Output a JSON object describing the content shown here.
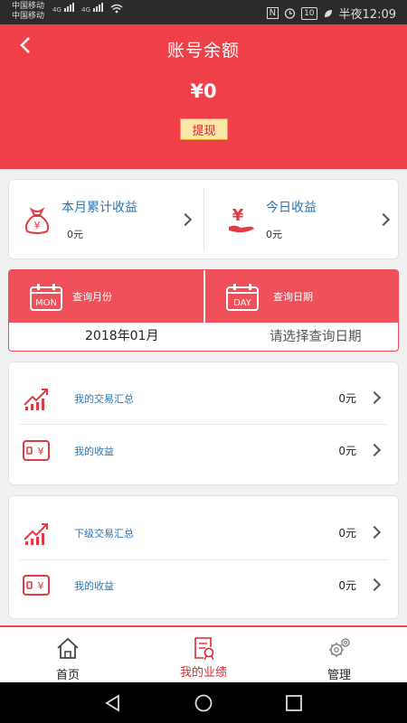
{
  "status": {
    "carrier1": "中国移动",
    "carrier2": "中国移动",
    "net1": "4G",
    "net2": "4G",
    "nfc": "N",
    "battery": "10",
    "time": "半夜12:09"
  },
  "header": {
    "title": "账号余额",
    "balance": "¥0",
    "withdraw_label": "提现"
  },
  "income": {
    "month": {
      "label": "本月累计收益",
      "value": "0元"
    },
    "today": {
      "label": "今日收益",
      "value": "0元"
    }
  },
  "query": {
    "month_label": "查询月份",
    "month_badge": "MON",
    "date_label": "查询日期",
    "date_badge": "DAY",
    "month_value": "2018年01月",
    "date_placeholder": "请选择查询日期"
  },
  "my_section": {
    "rows": [
      {
        "label": "我的交易汇总",
        "value": "0元",
        "icon": "chart-up-icon"
      },
      {
        "label": "我的收益",
        "value": "0元",
        "icon": "wallet-icon"
      }
    ]
  },
  "sub_section": {
    "rows": [
      {
        "label": "下级交易汇总",
        "value": "0元",
        "icon": "chart-up-icon"
      },
      {
        "label": "我的收益",
        "value": "0元",
        "icon": "wallet-icon"
      }
    ]
  },
  "tabs": [
    {
      "label": "首页",
      "icon": "home-icon"
    },
    {
      "label": "我的业绩",
      "icon": "performance-icon",
      "active": true
    },
    {
      "label": "管理",
      "icon": "gear-icon"
    }
  ],
  "colors": {
    "brand_red": "#ef3f48",
    "link_blue": "#2b74b5",
    "withdraw_bg": "#fbe6a8"
  }
}
